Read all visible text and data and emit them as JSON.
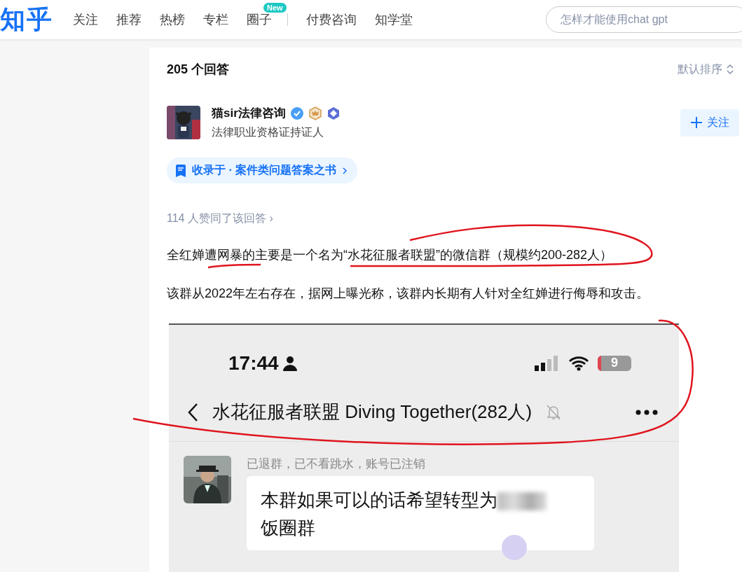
{
  "header": {
    "logo": "知乎",
    "nav": [
      {
        "label": "关注"
      },
      {
        "label": "推荐"
      },
      {
        "label": "热榜"
      },
      {
        "label": "专栏"
      },
      {
        "label": "圈子",
        "badge": "New"
      },
      {
        "label": "付费咨询"
      },
      {
        "label": "知学堂"
      }
    ],
    "search": {
      "placeholder": "怎样才能使用chat gpt"
    }
  },
  "answers": {
    "count": "205 个回答",
    "sort": "默认排序"
  },
  "author": {
    "name": "猫sir法律咨询",
    "headline": "法律职业资格证持证人",
    "follow_button": "关注"
  },
  "collection": "收录于 · 案件类问题答案之书",
  "votes": "114 人赞同了该回答 ›",
  "paragraphs": [
    "全红婵遭网暴的主要是一个名为“水花征服者联盟”的微信群（规模约200-282人）",
    "该群从2022年左右存在，据网上曝光称，该群内长期有人针对全红婵进行侮辱和攻击。"
  ],
  "screenshot": {
    "time": "17:44",
    "battery": "9",
    "chat_title": "水花征服者联盟 Diving Together(282人)",
    "messages": [
      {
        "sender": "已退群，已不看跳水，账号已注销",
        "lines": [
          "本群如果可以的话希望转型为",
          "饭圈群"
        ]
      }
    ]
  }
}
